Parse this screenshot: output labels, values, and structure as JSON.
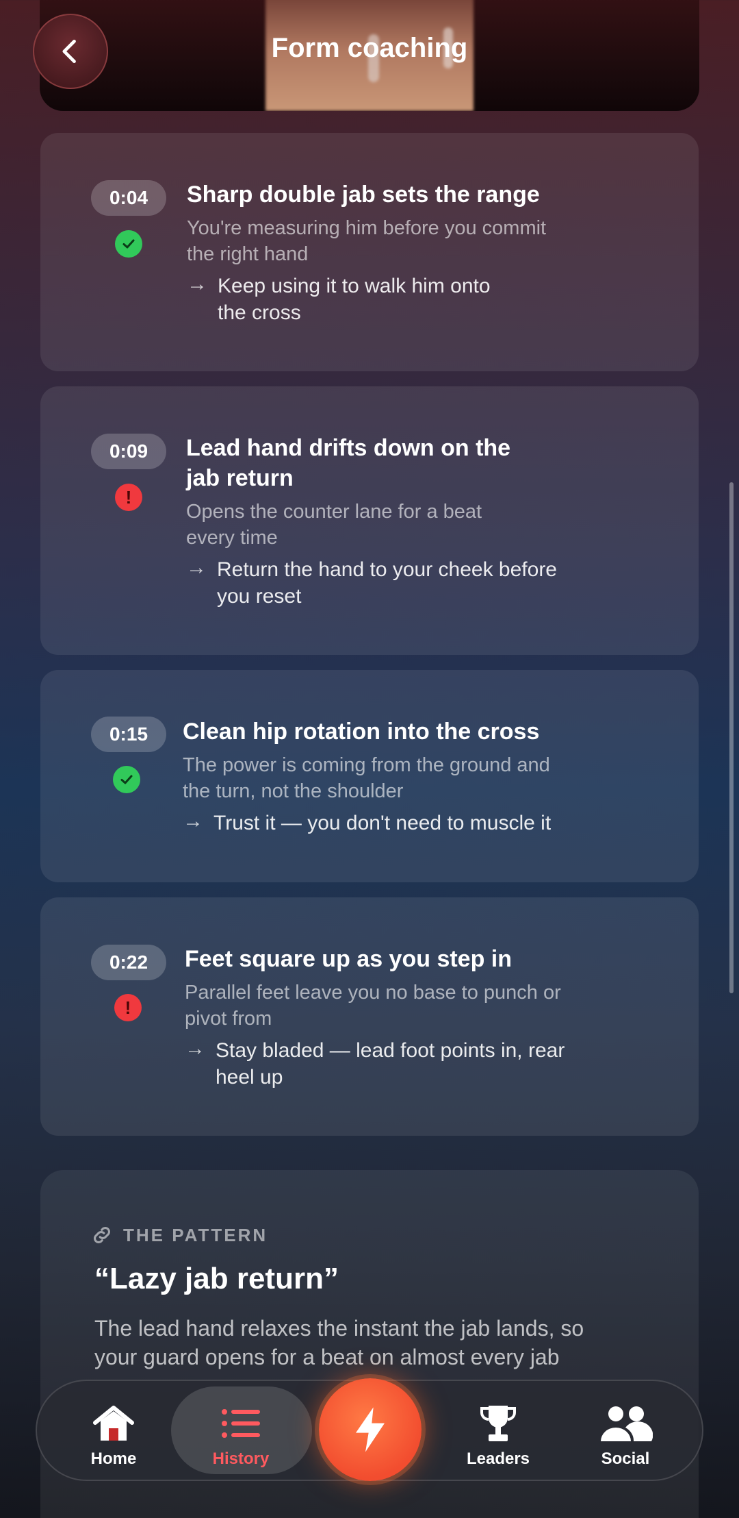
{
  "header": {
    "title": "Form coaching"
  },
  "cards": [
    {
      "time": "0:04",
      "status": "good",
      "title": "Sharp double jab sets the range",
      "sub1": "You're measuring him before you commit",
      "sub2": "the right hand",
      "tip1": "Keep using it to walk him onto",
      "tip2": "the cross"
    },
    {
      "time": "0:09",
      "status": "bad",
      "title1": "Lead hand drifts down on the",
      "title2": "jab return",
      "sub1": "Opens the counter lane for a beat",
      "sub2": "every time",
      "tip1": "Return the hand to your cheek before",
      "tip2": "you reset"
    },
    {
      "time": "0:15",
      "status": "good",
      "title": "Clean hip rotation into the cross",
      "sub1": "The power is coming from the ground and",
      "sub2": "the turn, not the shoulder",
      "tip1": "Trust it — you don't need to muscle it"
    },
    {
      "time": "0:22",
      "status": "bad",
      "title": "Feet square up as you step in",
      "sub1": "Parallel feet leave you no base to punch or",
      "sub2": "pivot from",
      "tip1": "Stay bladed — lead foot points in, rear",
      "tip2": "heel up"
    }
  ],
  "pattern": {
    "label": "THE PATTERN",
    "title": "“Lazy jab return”",
    "text1": "The lead hand relaxes the instant the jab lands, so",
    "text2": "your guard opens for a beat on almost every jab"
  },
  "tabs": {
    "home": "Home",
    "history": "History",
    "leaders": "Leaders",
    "social": "Social"
  },
  "colors": {
    "accent": "#f24d2f",
    "good": "#31c95a",
    "bad": "#f0393e",
    "active_tab": "#ff5a5f"
  }
}
